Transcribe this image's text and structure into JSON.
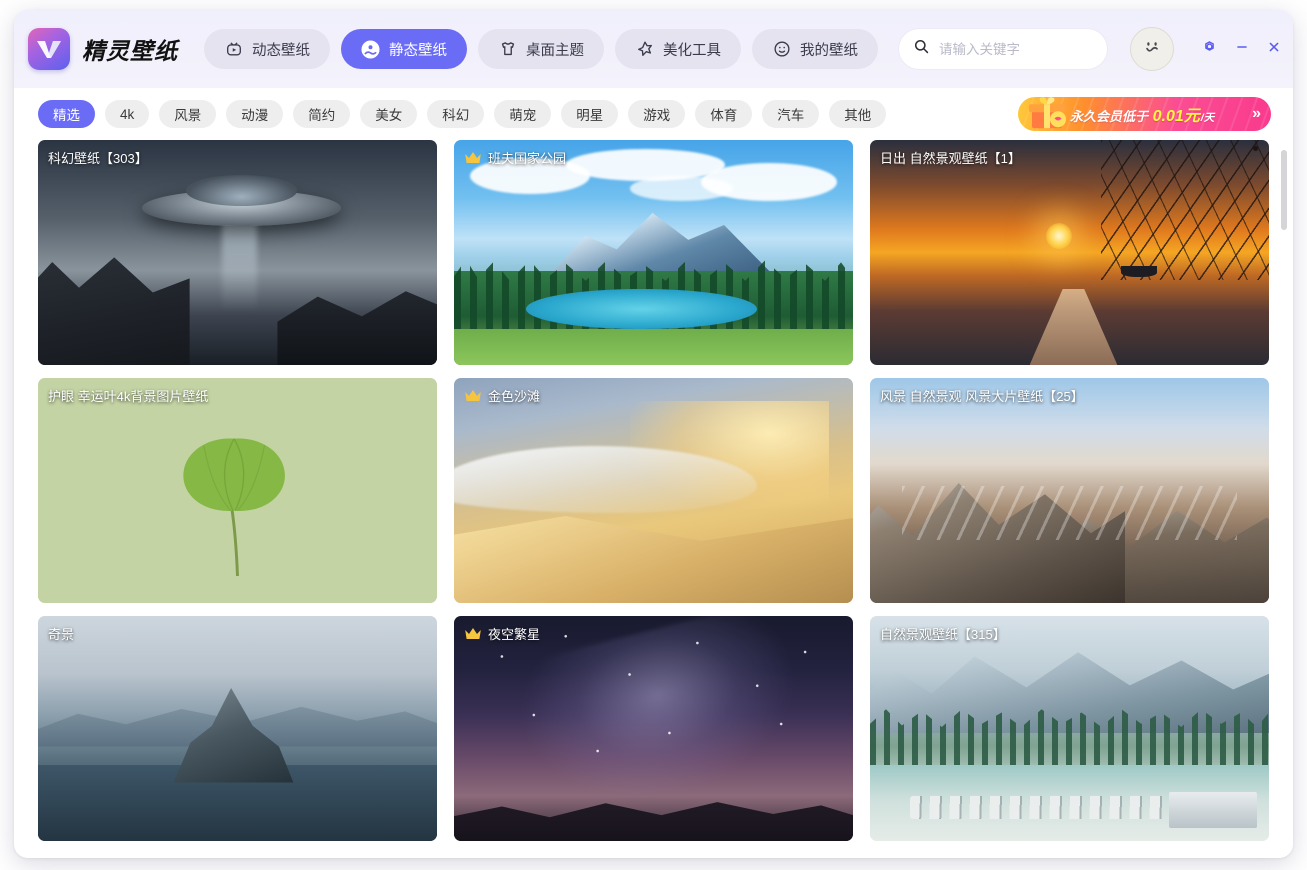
{
  "app": {
    "brand": "精灵壁纸",
    "logo_icon": "w-logo-icon"
  },
  "nav": {
    "tabs": [
      {
        "label": "动态壁纸",
        "icon": "live-wallpaper-icon",
        "active": false
      },
      {
        "label": "静态壁纸",
        "icon": "static-wallpaper-icon",
        "active": true
      },
      {
        "label": "桌面主题",
        "icon": "desktop-theme-icon",
        "active": false
      },
      {
        "label": "美化工具",
        "icon": "beautify-tool-icon",
        "active": false
      },
      {
        "label": "我的壁纸",
        "icon": "my-wallpaper-icon",
        "active": false
      }
    ]
  },
  "search": {
    "placeholder": "请输入关键字",
    "value": "",
    "icon": "search-icon"
  },
  "window_controls": {
    "avatar_icon": "smiley-avatar-icon",
    "settings_icon": "gear-icon",
    "minimize_icon": "minimize-icon",
    "close_icon": "close-icon"
  },
  "categories": [
    {
      "label": "精选",
      "active": true
    },
    {
      "label": "4k",
      "active": false
    },
    {
      "label": "风景",
      "active": false
    },
    {
      "label": "动漫",
      "active": false
    },
    {
      "label": "简约",
      "active": false
    },
    {
      "label": "美女",
      "active": false
    },
    {
      "label": "科幻",
      "active": false
    },
    {
      "label": "萌宠",
      "active": false
    },
    {
      "label": "明星",
      "active": false
    },
    {
      "label": "游戏",
      "active": false
    },
    {
      "label": "体育",
      "active": false
    },
    {
      "label": "汽车",
      "active": false
    },
    {
      "label": "其他",
      "active": false
    }
  ],
  "promo": {
    "gift_icon": "gift-box-icon",
    "text_prefix": "永久会员低于",
    "amount": "0.01元",
    "unit": "/天",
    "arrow": "»"
  },
  "gallery": {
    "cards": [
      {
        "title": "科幻壁纸【303】",
        "vip": false
      },
      {
        "title": "班夫国家公园",
        "vip": true
      },
      {
        "title": "日出 自然景观壁纸【1】",
        "vip": false
      },
      {
        "title": "护眼 幸运叶4k背景图片壁纸",
        "vip": false
      },
      {
        "title": "金色沙滩",
        "vip": true
      },
      {
        "title": "风景 自然景观 风景大片壁纸【25】",
        "vip": false
      },
      {
        "title": "奇景",
        "vip": false
      },
      {
        "title": "夜空繁星",
        "vip": true
      },
      {
        "title": "自然景观壁纸【315】",
        "vip": false
      }
    ]
  },
  "scrollbar": {
    "name": "vertical-scrollbar"
  },
  "colors": {
    "accent": "#6a6cf5",
    "chip_inactive": "#eeeeee",
    "header_bg": "#f1f0fb",
    "promo_start": "#ffc93a",
    "promo_end": "#f93a8d",
    "vip_crown": "#f6c540"
  }
}
